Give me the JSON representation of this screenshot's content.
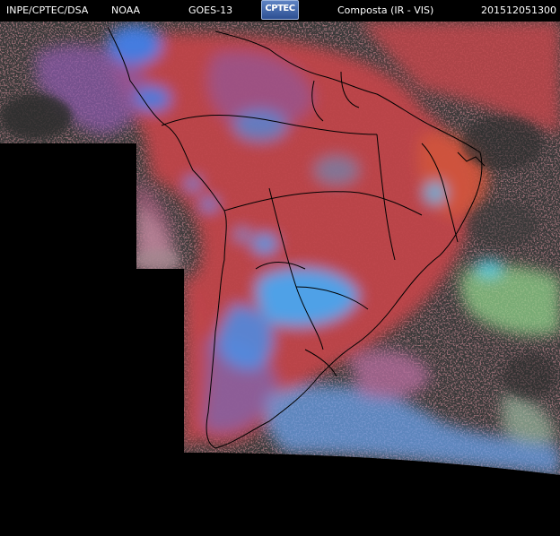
{
  "header": {
    "org": "INPE/CPTEC/DSA",
    "agency": "NOAA",
    "satellite": "GOES-13",
    "logo_text": "CPTEC",
    "product": "Composta (IR - VIS)",
    "timestamp": "201512051300"
  },
  "colors": {
    "background": "#000000",
    "land_ground": "#3a3a3a",
    "cloud_red": "#c0454a",
    "cloud_purple": "#8a5aa8",
    "cloud_blue": "#3f8fe8",
    "cloud_cyan": "#55b8e6",
    "cloud_green": "#8fd08a",
    "coastline": "#000000",
    "header_text": "#ffffff"
  }
}
